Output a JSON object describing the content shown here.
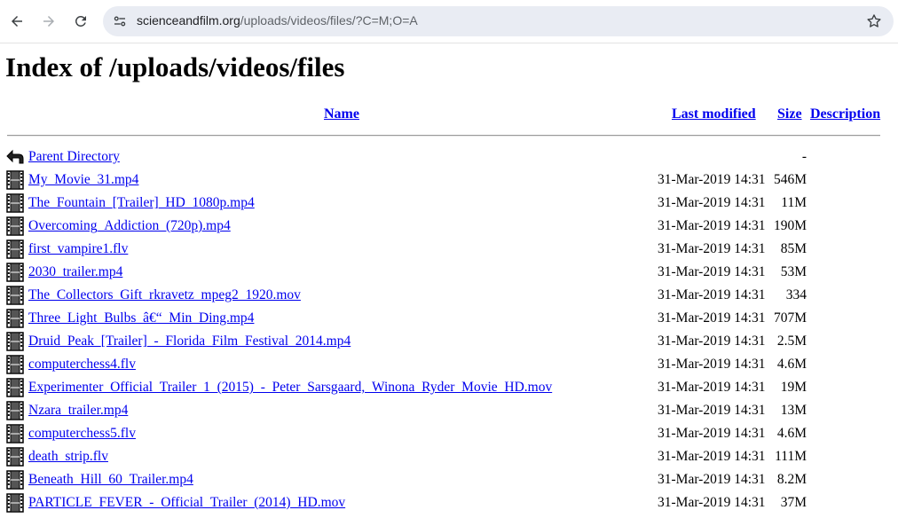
{
  "browser": {
    "url_host": "scienceandfilm.org",
    "url_path": "/uploads/videos/files/?C=M;O=A"
  },
  "page": {
    "title": "Index of /uploads/videos/files",
    "columns": {
      "name": "Name",
      "last_modified": "Last modified",
      "size": "Size",
      "description": "Description"
    }
  },
  "entries": [
    {
      "icon": "back-icon",
      "name": "Parent Directory",
      "date": "",
      "size": "-"
    },
    {
      "icon": "movie-icon",
      "name": "My_Movie_31.mp4",
      "date": "31-Mar-2019 14:31",
      "size": "546M"
    },
    {
      "icon": "movie-icon",
      "name": "The_Fountain_[Trailer]_HD_1080p.mp4",
      "date": "31-Mar-2019 14:31",
      "size": "11M"
    },
    {
      "icon": "movie-icon",
      "name": "Overcoming_Addiction_(720p).mp4",
      "date": "31-Mar-2019 14:31",
      "size": "190M"
    },
    {
      "icon": "movie-icon",
      "name": "first_vampire1.flv",
      "date": "31-Mar-2019 14:31",
      "size": "85M"
    },
    {
      "icon": "movie-icon",
      "name": "2030_trailer.mp4",
      "date": "31-Mar-2019 14:31",
      "size": "53M"
    },
    {
      "icon": "movie-icon",
      "name": "The_Collectors_Gift_rkravetz_mpeg2_1920.mov",
      "date": "31-Mar-2019 14:31",
      "size": "334"
    },
    {
      "icon": "movie-icon",
      "name": "Three_Light_Bulbs_â€“_Min_Ding.mp4",
      "date": "31-Mar-2019 14:31",
      "size": "707M"
    },
    {
      "icon": "movie-icon",
      "name": "Druid_Peak_[Trailer]_-_Florida_Film_Festival_2014.mp4",
      "date": "31-Mar-2019 14:31",
      "size": "2.5M"
    },
    {
      "icon": "movie-icon",
      "name": "computerchess4.flv",
      "date": "31-Mar-2019 14:31",
      "size": "4.6M"
    },
    {
      "icon": "movie-icon",
      "name": "Experimenter_Official_Trailer_1_(2015)_-_Peter_Sarsgaard,_Winona_Ryder_Movie_HD.mov",
      "date": "31-Mar-2019 14:31",
      "size": "19M"
    },
    {
      "icon": "movie-icon",
      "name": "Nzara_trailer.mp4",
      "date": "31-Mar-2019 14:31",
      "size": "13M"
    },
    {
      "icon": "movie-icon",
      "name": "computerchess5.flv",
      "date": "31-Mar-2019 14:31",
      "size": "4.6M"
    },
    {
      "icon": "movie-icon",
      "name": "death_strip.flv",
      "date": "31-Mar-2019 14:31",
      "size": "111M"
    },
    {
      "icon": "movie-icon",
      "name": "Beneath_Hill_60_Trailer.mp4",
      "date": "31-Mar-2019 14:31",
      "size": "8.2M"
    },
    {
      "icon": "movie-icon",
      "name": "PARTICLE_FEVER_-_Official_Trailer_(2014)_HD.mov",
      "date": "31-Mar-2019 14:31",
      "size": "37M"
    }
  ]
}
